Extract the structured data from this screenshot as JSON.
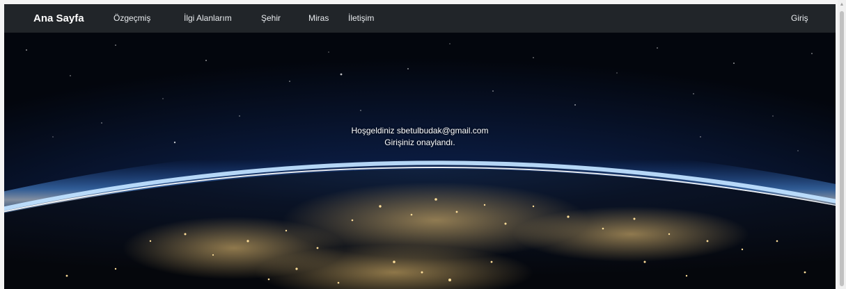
{
  "navbar": {
    "brand": "Ana Sayfa",
    "links": [
      {
        "label": "Özgeçmiş"
      },
      {
        "label": "İlgi Alanlarım"
      },
      {
        "label": "Şehir"
      },
      {
        "label": "Miras"
      },
      {
        "label": "İletişim"
      }
    ],
    "login": "Giriş"
  },
  "hero": {
    "welcome": "Hoşgeldiniz sbetulbudak@gmail.com",
    "confirmed": "Girişiniz onaylandı."
  },
  "colors": {
    "navbar_bg": "#212529",
    "nav_text": "#e9ecef",
    "space_bg": "#050a14",
    "atmosphere_glow": "#6fb5ff"
  },
  "icons": {
    "scroll_up": "arrow-up-icon"
  }
}
